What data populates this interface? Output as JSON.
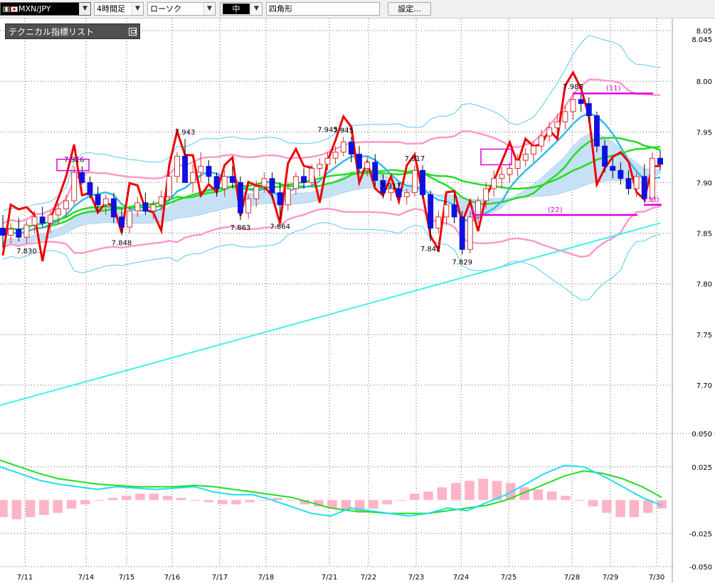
{
  "toolbar": {
    "pair": "MXN/JPY",
    "timeframe": "4時間足",
    "chart_type": "ローソク",
    "size": "中",
    "shape": "四角形",
    "settings_label": "設定..."
  },
  "indicator_panel": {
    "title": "テクニカル指標リスト"
  },
  "colors": {
    "bull": "#d03030",
    "bear": "#1010e0",
    "signal_line": "#ee0000",
    "ma_short": "#33bbee",
    "ma_mid": "#22dd22",
    "ma_long": "#44eeee",
    "bb_band": "#ff99cc",
    "bb_outer": "#55ccee",
    "cloud": "#c6e0f5",
    "markers": "#dd00dd",
    "macd_hist": "#ffb3c6"
  },
  "chart_data": [
    {
      "type": "candlestick",
      "y_axis": {
        "min": 7.7,
        "max": 8.05,
        "ticks": [
          "8.05",
          "8.045",
          "8.00",
          "7.95",
          "7.90",
          "7.85",
          "7.80",
          "7.75",
          "7.70"
        ]
      },
      "x_ticks": [
        "7/11",
        "7/14",
        "7/15",
        "7/16",
        "7/17",
        "7/18",
        "7/21",
        "7/22",
        "7/23",
        "7/24",
        "7/25",
        "7/28",
        "7/29",
        "7/30"
      ],
      "grid": true,
      "candles": [
        [
          7.855,
          7.868,
          7.836,
          7.848
        ],
        [
          7.848,
          7.86,
          7.84,
          7.854
        ],
        [
          7.854,
          7.865,
          7.842,
          7.846
        ],
        [
          7.846,
          7.862,
          7.84,
          7.858
        ],
        [
          7.858,
          7.872,
          7.85,
          7.866
        ],
        [
          7.866,
          7.876,
          7.856,
          7.86
        ],
        [
          7.86,
          7.872,
          7.85,
          7.868
        ],
        [
          7.868,
          7.88,
          7.858,
          7.874
        ],
        [
          7.874,
          7.888,
          7.866,
          7.882
        ],
        [
          7.882,
          7.916,
          7.878,
          7.91
        ],
        [
          7.91,
          7.916,
          7.898,
          7.9
        ],
        [
          7.9,
          7.906,
          7.884,
          7.888
        ],
        [
          7.888,
          7.896,
          7.872,
          7.878
        ],
        [
          7.878,
          7.888,
          7.868,
          7.884
        ],
        [
          7.884,
          7.89,
          7.86,
          7.866
        ],
        [
          7.866,
          7.874,
          7.848,
          7.856
        ],
        [
          7.856,
          7.876,
          7.85,
          7.872
        ],
        [
          7.872,
          7.886,
          7.866,
          7.88
        ],
        [
          7.88,
          7.89,
          7.868,
          7.872
        ],
        [
          7.872,
          7.882,
          7.864,
          7.878
        ],
        [
          7.878,
          7.892,
          7.872,
          7.886
        ],
        [
          7.886,
          7.91,
          7.882,
          7.906
        ],
        [
          7.906,
          7.93,
          7.9,
          7.926
        ],
        [
          7.926,
          7.943,
          7.91,
          7.9
        ],
        [
          7.9,
          7.918,
          7.89,
          7.91
        ],
        [
          7.91,
          7.93,
          7.9,
          7.916
        ],
        [
          7.916,
          7.922,
          7.9,
          7.906
        ],
        [
          7.906,
          7.91,
          7.886,
          7.894
        ],
        [
          7.894,
          7.912,
          7.886,
          7.906
        ],
        [
          7.906,
          7.916,
          7.894,
          7.9
        ],
        [
          7.9,
          7.906,
          7.863,
          7.87
        ],
        [
          7.87,
          7.888,
          7.864,
          7.884
        ],
        [
          7.884,
          7.902,
          7.876,
          7.896
        ],
        [
          7.896,
          7.91,
          7.89,
          7.904
        ],
        [
          7.904,
          7.91,
          7.884,
          7.89
        ],
        [
          7.89,
          7.9,
          7.864,
          7.878
        ],
        [
          7.878,
          7.9,
          7.872,
          7.894
        ],
        [
          7.894,
          7.91,
          7.888,
          7.906
        ],
        [
          7.906,
          7.914,
          7.894,
          7.9
        ],
        [
          7.9,
          7.918,
          7.896,
          7.914
        ],
        [
          7.914,
          7.924,
          7.906,
          7.918
        ],
        [
          7.918,
          7.93,
          7.912,
          7.924
        ],
        [
          7.924,
          7.936,
          7.918,
          7.93
        ],
        [
          7.93,
          7.945,
          7.926,
          7.94
        ],
        [
          7.94,
          7.945,
          7.92,
          7.928
        ],
        [
          7.928,
          7.936,
          7.91,
          7.914
        ],
        [
          7.914,
          7.926,
          7.906,
          7.92
        ],
        [
          7.92,
          7.928,
          7.896,
          7.902
        ],
        [
          7.902,
          7.908,
          7.884,
          7.89
        ],
        [
          7.89,
          7.9,
          7.882,
          7.894
        ],
        [
          7.894,
          7.9,
          7.884,
          7.886
        ],
        [
          7.886,
          7.894,
          7.878,
          7.89
        ],
        [
          7.89,
          7.917,
          7.886,
          7.912
        ],
        [
          7.912,
          7.917,
          7.884,
          7.888
        ],
        [
          7.888,
          7.892,
          7.842,
          7.855
        ],
        [
          7.855,
          7.872,
          7.85,
          7.866
        ],
        [
          7.866,
          7.884,
          7.858,
          7.878
        ],
        [
          7.878,
          7.888,
          7.86,
          7.866
        ],
        [
          7.866,
          7.872,
          7.829,
          7.834
        ],
        [
          7.834,
          7.872,
          7.83,
          7.866
        ],
        [
          7.866,
          7.886,
          7.86,
          7.882
        ],
        [
          7.882,
          7.9,
          7.874,
          7.894
        ],
        [
          7.894,
          7.912,
          7.886,
          7.904
        ],
        [
          7.904,
          7.916,
          7.894,
          7.908
        ],
        [
          7.908,
          7.92,
          7.9,
          7.914
        ],
        [
          7.914,
          7.928,
          7.906,
          7.922
        ],
        [
          7.922,
          7.934,
          7.916,
          7.928
        ],
        [
          7.928,
          7.94,
          7.92,
          7.936
        ],
        [
          7.936,
          7.952,
          7.93,
          7.946
        ],
        [
          7.946,
          7.96,
          7.94,
          7.954
        ],
        [
          7.954,
          7.968,
          7.946,
          7.96
        ],
        [
          7.96,
          7.976,
          7.952,
          7.97
        ],
        [
          7.97,
          7.988,
          7.962,
          7.982
        ],
        [
          7.982,
          7.988,
          7.97,
          7.978
        ],
        [
          7.978,
          7.984,
          7.96,
          7.966
        ],
        [
          7.966,
          7.97,
          7.93,
          7.936
        ],
        [
          7.936,
          7.942,
          7.91,
          7.916
        ],
        [
          7.916,
          7.924,
          7.904,
          7.912
        ],
        [
          7.912,
          7.92,
          7.898,
          7.904
        ],
        [
          7.904,
          7.912,
          7.888,
          7.894
        ],
        [
          7.894,
          7.91,
          7.886,
          7.906
        ],
        [
          7.906,
          7.918,
          7.88,
          7.884
        ],
        [
          7.884,
          7.93,
          7.88,
          7.924
        ],
        [
          7.924,
          7.932,
          7.912,
          7.918
        ]
      ],
      "price_labels": [
        {
          "text": "7.830",
          "index": 3,
          "at": "low"
        },
        {
          "text": "7.916",
          "index": 9,
          "at": "high"
        },
        {
          "text": "7.848",
          "index": 15,
          "at": "low"
        },
        {
          "text": "7.943",
          "index": 23,
          "at": "high"
        },
        {
          "text": "7.863",
          "index": 30,
          "at": "low"
        },
        {
          "text": "7.864",
          "index": 35,
          "at": "low"
        },
        {
          "text": "7.945",
          "index": 43,
          "at": "high"
        },
        {
          "text": "7.945",
          "index": 41,
          "at": "high-upper"
        },
        {
          "text": "7.917",
          "index": 52,
          "at": "high"
        },
        {
          "text": "7.917",
          "index": 49,
          "at": "high-lower"
        },
        {
          "text": "7.842",
          "index": 54,
          "at": "low"
        },
        {
          "text": "7.829",
          "index": 58,
          "at": "low"
        },
        {
          "text": "7.988",
          "index": 72,
          "at": "high"
        }
      ],
      "markers": [
        {
          "text": "(11)",
          "price": 7.988
        },
        {
          "text": "(22)",
          "price": 7.868
        },
        {
          "text": "(33)",
          "price": 7.878
        }
      ]
    },
    {
      "type": "macd",
      "y_axis": {
        "min": -0.05,
        "max": 0.05,
        "ticks": [
          "0.050",
          "0.025",
          "-0.025",
          "-0.050"
        ]
      },
      "macd_line": [
        0.025,
        0.02,
        0.015,
        0.012,
        0.01,
        0.008,
        0.01,
        0.009,
        0.008,
        0.009,
        0.01,
        0.006,
        0.004,
        0.004,
        0.0,
        -0.005,
        -0.01,
        -0.012,
        -0.006,
        -0.008,
        -0.01,
        -0.012,
        -0.01,
        -0.006,
        -0.008,
        -0.002,
        0.004,
        0.012,
        0.02,
        0.026,
        0.025,
        0.018,
        0.01,
        0.002,
        -0.004
      ],
      "signal_line": [
        0.03,
        0.025,
        0.02,
        0.016,
        0.014,
        0.012,
        0.011,
        0.01,
        0.01,
        0.01,
        0.011,
        0.01,
        0.008,
        0.006,
        0.004,
        0.002,
        -0.002,
        -0.006,
        -0.008,
        -0.009,
        -0.01,
        -0.01,
        -0.01,
        -0.008,
        -0.006,
        -0.004,
        0.0,
        0.006,
        0.012,
        0.018,
        0.022,
        0.02,
        0.016,
        0.01,
        0.002
      ],
      "histogram": [
        -0.008,
        -0.009,
        -0.008,
        -0.007,
        -0.006,
        -0.004,
        -0.002,
        0.0,
        0.001,
        0.002,
        0.003,
        0.003,
        0.002,
        0.001,
        0.0,
        -0.001,
        -0.002,
        -0.002,
        -0.001,
        0.0,
        0.001,
        0.0,
        -0.002,
        -0.003,
        -0.004,
        -0.005,
        -0.006,
        -0.004,
        -0.002,
        0.0,
        0.003,
        0.004,
        0.006,
        0.008,
        0.009,
        0.01,
        0.009,
        0.008,
        0.006,
        0.005,
        0.004,
        0.002,
        0.0,
        -0.003,
        -0.006,
        -0.008,
        -0.008,
        -0.006,
        -0.004
      ]
    }
  ]
}
